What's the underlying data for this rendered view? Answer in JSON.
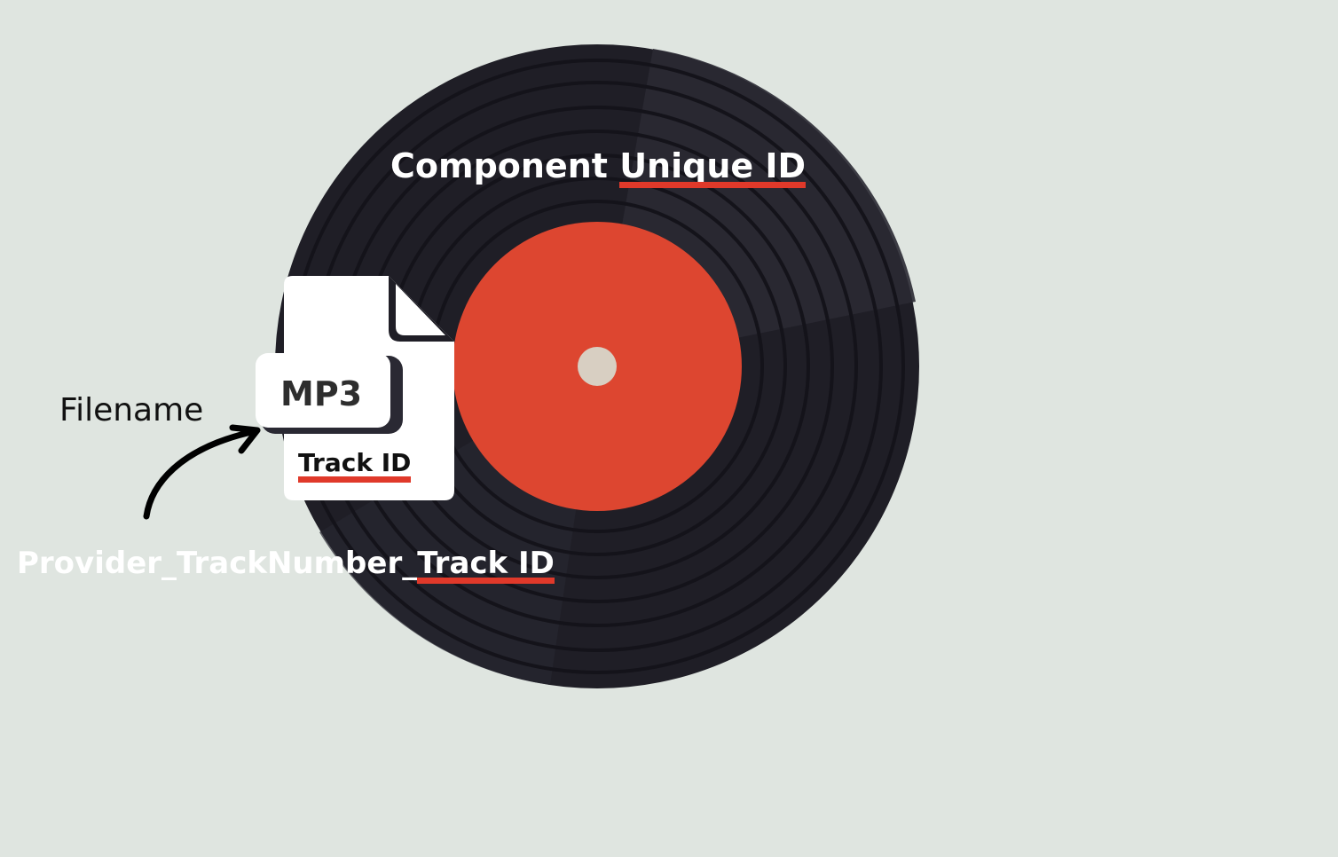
{
  "title": {
    "prefix": "Component",
    "highlight": "Unique ID"
  },
  "file": {
    "type_label": "MP3",
    "id_label": "Track ID"
  },
  "filename_label": "Filename",
  "pattern": {
    "prefix": "Provider_TrackNumber_",
    "highlight": "Track ID"
  },
  "colors": {
    "background": "#dfe5e0",
    "record": "#24232c",
    "label": "#dd4630",
    "spindle": "#d8cfc2",
    "underline": "#e0392a"
  },
  "icons": {
    "record": "vinyl-record-icon",
    "file": "mp3-file-icon",
    "arrow": "curved-arrow-icon"
  }
}
